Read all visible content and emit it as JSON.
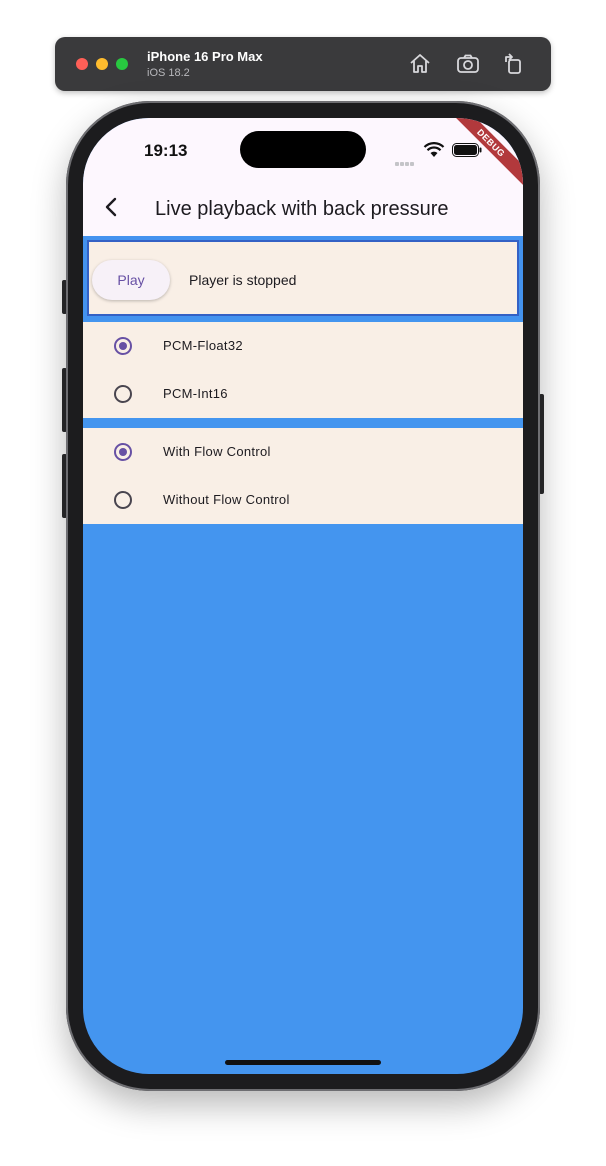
{
  "simulator": {
    "device_name": "iPhone 16 Pro Max",
    "os_version": "iOS 18.2",
    "home_icon": "home-icon",
    "screenshot_icon": "camera-icon",
    "rotate_icon": "rotate-icon"
  },
  "status_bar": {
    "time": "19:13",
    "debug_label": "DEBUG"
  },
  "app_bar": {
    "back_icon": "chevron-left-icon",
    "title": "Live playback with back pressure"
  },
  "player": {
    "play_label": "Play",
    "status": "Player is stopped"
  },
  "format_options": [
    {
      "label": "PCM-Float32",
      "selected": true
    },
    {
      "label": "PCM-Int16",
      "selected": false
    }
  ],
  "flow_options": [
    {
      "label": "With Flow Control",
      "selected": true
    },
    {
      "label": "Without Flow Control",
      "selected": false
    }
  ],
  "colors": {
    "background_blue": "#4495ef",
    "tile_cream": "#f9efe6",
    "accent_purple": "#6750a4",
    "debug_red": "#b2393c"
  }
}
